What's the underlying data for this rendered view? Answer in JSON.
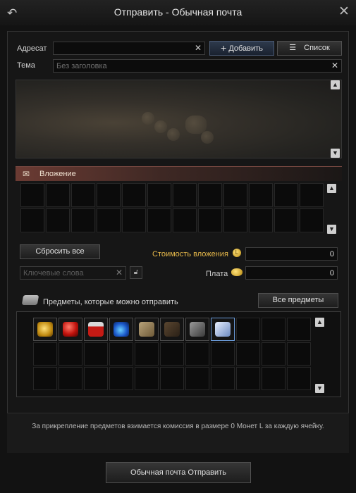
{
  "window": {
    "title": "Отправить - Обычная почта"
  },
  "recipient": {
    "label": "Адресат",
    "value": "",
    "add_label": "Добавить",
    "list_label": "Список"
  },
  "subject": {
    "label": "Тема",
    "placeholder": "Без заголовка"
  },
  "attachment": {
    "header": "Вложение",
    "reset_label": "Сбросить все",
    "cost_label": "Стоимость вложения",
    "cost_value": "0",
    "keywords_placeholder": "Ключевые слова",
    "fee_label": "Плата",
    "fee_value": "0"
  },
  "items": {
    "label": "Предметы, которые можно отправить",
    "all_items_label": "Все предметы",
    "icons": [
      "gold-coins-icon",
      "red-orb-icon",
      "red-potion-icon",
      "blue-potion-icon",
      "scroll-sack-icon",
      "branch-icon",
      "hammer-icon",
      "scroll-icon"
    ]
  },
  "footer": {
    "note": "За прикрепление предметов взимается комиссия в размере 0 Монет L за каждую ячейку.",
    "send_label": "Обычная почта Отправить"
  }
}
